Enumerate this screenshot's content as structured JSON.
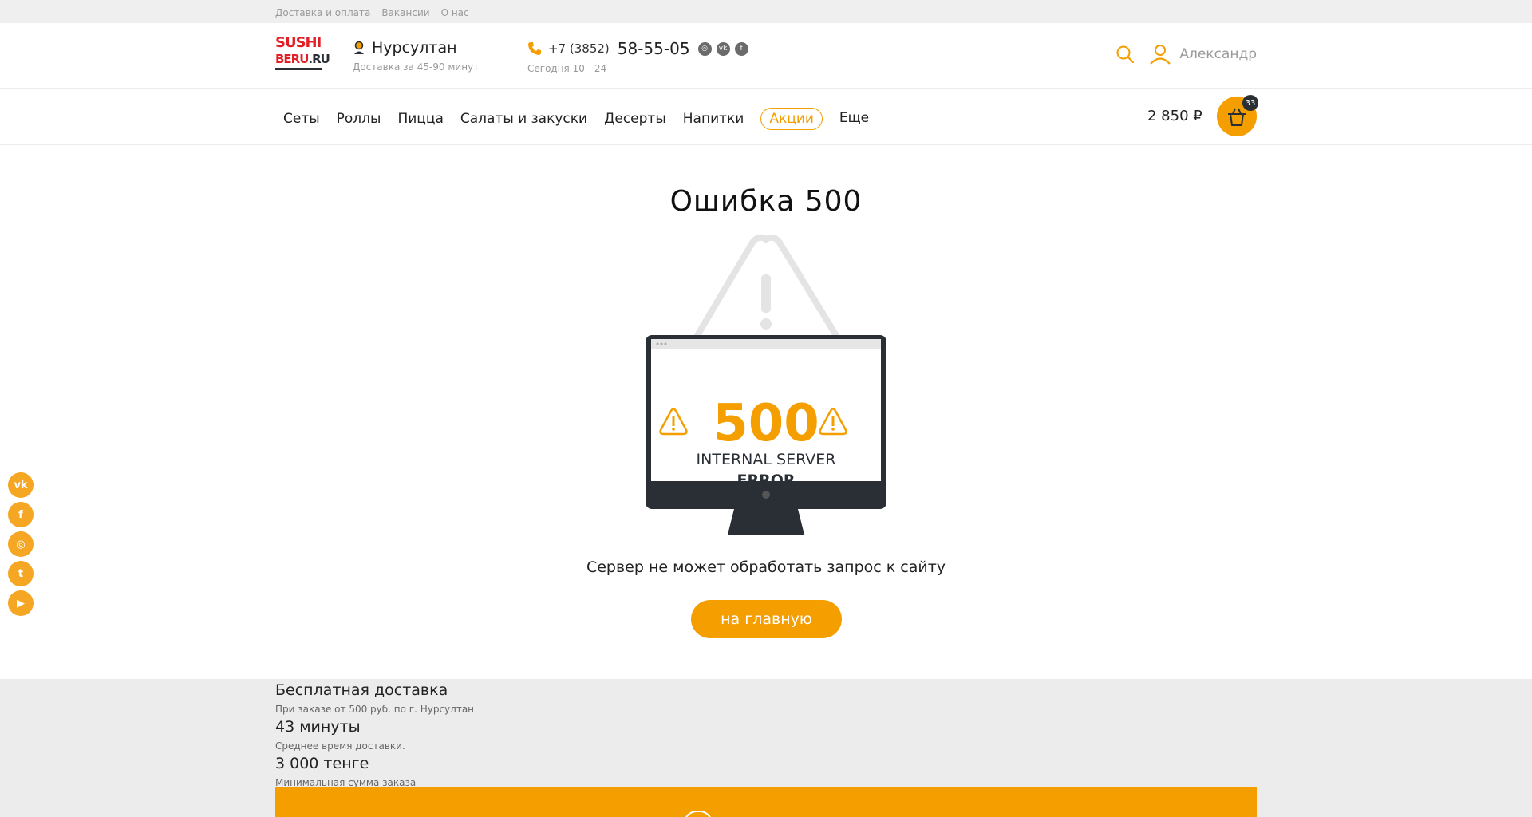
{
  "topbar": {
    "links": [
      "Доставка и оплата",
      "Вакансии",
      "О нас"
    ]
  },
  "logo": {
    "line1": "SUSHI",
    "line2_red": "BERU",
    "line2_dark": ".RU"
  },
  "city": {
    "name": "Нурсултан",
    "delivery_time": "Доставка за 45-90 минут"
  },
  "phone": {
    "code": "+7 (3852)",
    "number": "58-55-05",
    "hours": "Сегодня 10 - 24",
    "socials": [
      "instagram-icon",
      "vk-icon",
      "fs-icon"
    ]
  },
  "user": {
    "name": "Александр"
  },
  "nav": {
    "items": [
      "Сеты",
      "Роллы",
      "Пицца",
      "Салаты и закуски",
      "Десерты",
      "Напитки"
    ],
    "promo": "Акции",
    "more": "Еще"
  },
  "cart": {
    "total": "2 850 ₽",
    "count": "33"
  },
  "error": {
    "title": "Ошибка 500",
    "code": "500",
    "label1": "INTERNAL SERVER",
    "label2": "ERROR",
    "message": "Сервер не может обработать запрос к сайту",
    "button": "на главную"
  },
  "side_social": [
    "vk",
    "f",
    "ig",
    "tw",
    "yt"
  ],
  "footer": {
    "free_title": "Бесплатная доставка",
    "free_sub": "При заказе от 500 руб. по г. Нурсултан",
    "time_title": "43 минуты",
    "time_sub": "Среднее время доставки.",
    "min_title": "3 000 тенге",
    "min_sub": "Минимальная сумма заказа"
  },
  "colors": {
    "accent": "#f59e00",
    "brand_red": "#e11f26",
    "dark": "#2a2f35"
  }
}
